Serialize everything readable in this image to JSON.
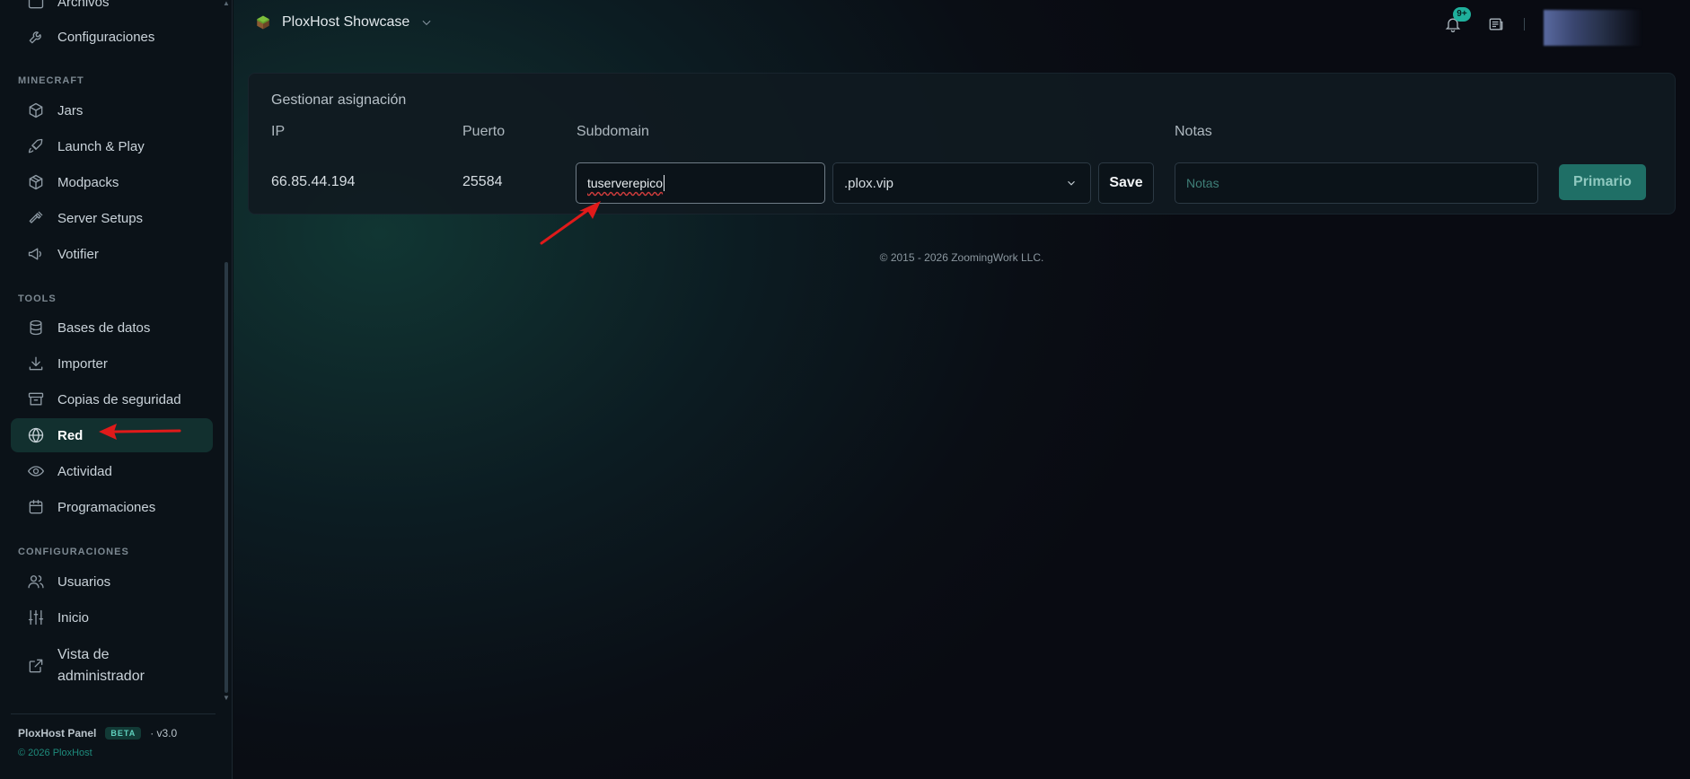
{
  "sidebar": {
    "partial_top_item": "Archivos",
    "top_items": [
      {
        "label": "Configuraciones",
        "icon": "wrench-icon"
      }
    ],
    "sections": [
      {
        "title": "MINECRAFT",
        "items": [
          {
            "label": "Jars",
            "icon": "cube-icon"
          },
          {
            "label": "Launch & Play",
            "icon": "rocket-icon"
          },
          {
            "label": "Modpacks",
            "icon": "box-icon"
          },
          {
            "label": "Server Setups",
            "icon": "hammer-icon"
          },
          {
            "label": "Votifier",
            "icon": "megaphone-icon"
          }
        ]
      },
      {
        "title": "TOOLS",
        "items": [
          {
            "label": "Bases de datos",
            "icon": "database-icon"
          },
          {
            "label": "Importer",
            "icon": "download-icon"
          },
          {
            "label": "Copias de seguridad",
            "icon": "archive-icon"
          },
          {
            "label": "Red",
            "icon": "globe-icon",
            "active": true
          },
          {
            "label": "Actividad",
            "icon": "eye-icon"
          },
          {
            "label": "Programaciones",
            "icon": "calendar-icon"
          }
        ]
      },
      {
        "title": "CONFIGURACIONES",
        "items": [
          {
            "label": "Usuarios",
            "icon": "users-icon"
          },
          {
            "label": "Inicio",
            "icon": "sliders-icon"
          },
          {
            "label": "Vista de administrador",
            "icon": "external-link-icon"
          }
        ]
      }
    ],
    "footer": {
      "brand": "PloxHost Panel",
      "badge": "BETA",
      "version": "· v3.0",
      "copyright": "© 2026 PloxHost"
    }
  },
  "header": {
    "server_name": "PloxHost Showcase",
    "notification_badge": "9+"
  },
  "allocation": {
    "title": "Gestionar asignación",
    "columns": {
      "ip": "IP",
      "port": "Puerto",
      "subdomain": "Subdomain",
      "notes": "Notas"
    },
    "row": {
      "ip": "66.85.44.194",
      "port": "25584",
      "subdomain_value": "tuserverepico",
      "domain_selected": ".plox.vip",
      "save_label": "Save",
      "notes_placeholder": "Notas",
      "primary_label": "Primario"
    }
  },
  "footer": {
    "copyright": "© 2015 - 2026 ZoomingWork LLC."
  },
  "colors": {
    "accent": "#1fb09c",
    "active_nav_bg": "#12302f",
    "annotation_arrow": "#e01a1a"
  }
}
